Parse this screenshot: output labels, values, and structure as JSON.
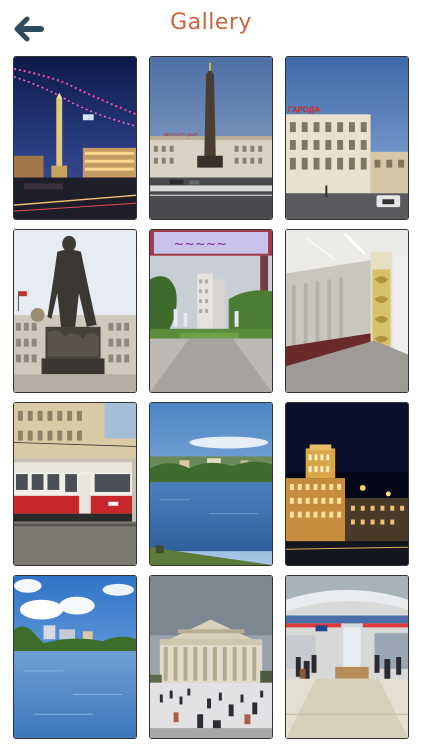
{
  "header": {
    "title": "Gallery",
    "back_icon": "arrow-left-icon",
    "title_color": "#c8643a",
    "back_color": "#2f4a5c"
  },
  "gallery": {
    "photos": [
      {
        "scene": "night square with obelisk and festive lights",
        "building_sign": ""
      },
      {
        "scene": "victory obelisk on square by day",
        "building_sign": "ВЕЛАСРАДЫЯ"
      },
      {
        "scene": "building with red rooftop sign",
        "building_sign": "ГАРОДА"
      },
      {
        "scene": "statue in front of government building"
      },
      {
        "scene": "park alley with high-rise and mural"
      },
      {
        "scene": "metro station platform with ornamented columns"
      },
      {
        "scene": "red and white tram in front of yellow building"
      },
      {
        "scene": "river view with green island"
      },
      {
        "scene": "night view of illuminated tower building"
      },
      {
        "scene": "lake with trees and clouds"
      },
      {
        "scene": "theatre with columns and crowd on square"
      },
      {
        "scene": "modern metro station with people"
      }
    ]
  }
}
